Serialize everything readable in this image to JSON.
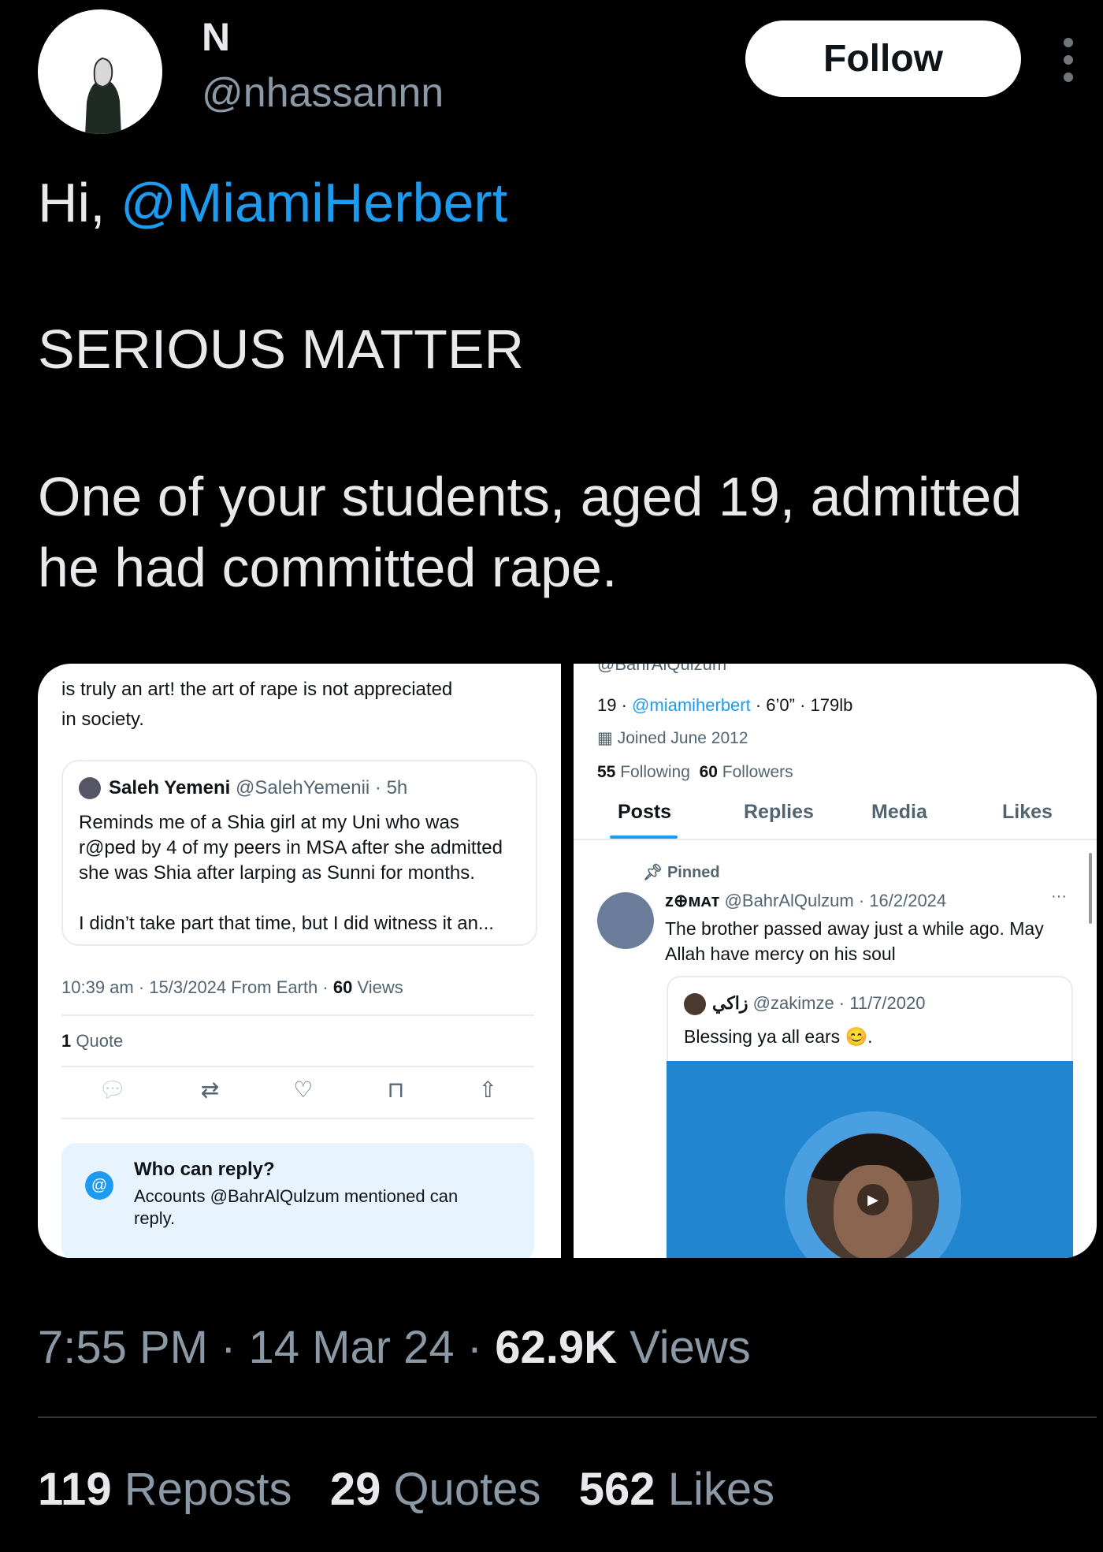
{
  "header": {
    "name": "N",
    "handle": "@nhassannn",
    "follow_label": "Follow"
  },
  "tweet": {
    "greeting": "Hi, ",
    "mention": "@MiamiHerbert",
    "line2": "SERIOUS MATTER",
    "line3": "One of your students, aged 19, admitted",
    "line4": "he had committed rape."
  },
  "left_card": {
    "top_text_1": "is truly an art! the art of rape is not appreciated",
    "top_text_2": "in society.",
    "quote": {
      "name": "Saleh Yemeni",
      "handle_time": "@SalehYemenii · 5h",
      "line1": "Reminds me of a Shia girl at my Uni who was",
      "line2": "r@ped by 4 of my peers in MSA after she admitted",
      "line3": "she was Shia after larping as Sunni for months.",
      "line4": "I didn’t take part that time, but I did witness it an..."
    },
    "meta": "10:39 am · 15/3/2024 From Earth · ",
    "views_count": "60",
    "views_label": " Views",
    "quote_count": "1",
    "quote_label": " Quote",
    "reply_title": "Who can reply?",
    "reply_line1": "Accounts @BahrAlQulzum mentioned can",
    "reply_line2": "reply."
  },
  "right_card": {
    "top_cut": "@BahrAlQulzum",
    "profile_line_age": "19 · ",
    "profile_line_link": "@miamiherbert",
    "profile_line_rest": " · 6’0” · 179lb",
    "joined": "Joined June 2012",
    "following_count": "55",
    "following_label": " Following",
    "followers_count": "60",
    "followers_label": " Followers",
    "tabs": [
      "Posts",
      "Replies",
      "Media",
      "Likes"
    ],
    "pinned": "Pinned",
    "post_name": "ᴢ⊕ᴍᴀᴛ",
    "post_handle_time": "@BahrAlQulzum · 16/2/2024",
    "post_line1": "The brother passed away just a while ago. May",
    "post_line2": "Allah have mercy on his soul",
    "inner_name": "زاكي",
    "inner_handle_time": "@zakimze · 11/7/2020",
    "inner_text": "Blessing ya all ears",
    "inner_emoji": "😊."
  },
  "footer": {
    "time": "7:55 PM · 14 Mar 24 · ",
    "views_count": "62.9K",
    "views_label": " Views",
    "reposts_count": "119",
    "reposts_label": " Reposts",
    "quotes_count": "29",
    "quotes_label": " Quotes",
    "likes_count": "562",
    "likes_label": " Likes"
  },
  "colors": {
    "background": "#000000",
    "mention_blue": "#1d9bf0",
    "muted": "#8b98a5"
  }
}
